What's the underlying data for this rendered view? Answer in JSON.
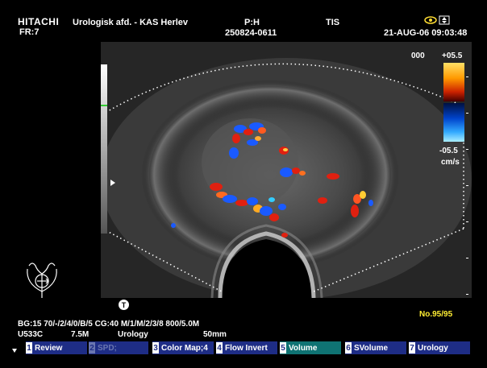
{
  "header": {
    "brand": "HITACHI",
    "frame_rate": "FR:7",
    "institution": "Urologisk afd. - KAS Herlev",
    "patient_label": "P:H",
    "patient_id": "250824-0611",
    "tis": "TIS",
    "datetime": "21-AUG-06 09:03:48"
  },
  "color_scale": {
    "code": "000",
    "max": "+05.5",
    "min": "-05.5",
    "unit": "cm/s"
  },
  "settings": {
    "line1": "BG:15    70/-/2/4/0/B/5    CG:40   M/1/M/2/3/8 800/5.0M",
    "line2_probe": "U533C",
    "line2_freq": "7.5M",
    "line2_preset": "Urology",
    "line2_depth": "50mm"
  },
  "frame_counter": "No.95/95",
  "marker_label": "T",
  "softkeys": [
    {
      "num": "1",
      "label": "Review"
    },
    {
      "num": "2",
      "label": "SPD;"
    },
    {
      "num": "3",
      "label": "Color Map;4"
    },
    {
      "num": "4",
      "label": "Flow Invert"
    },
    {
      "num": "5",
      "label": "Volume"
    },
    {
      "num": "6",
      "label": "SVolume"
    },
    {
      "num": "7",
      "label": "Urology"
    }
  ],
  "colors": {
    "softkey_bg": "#1e2d86",
    "softkey_teal": "#0f7373",
    "frame_counter": "#ffee33",
    "flow_red": "#e02010",
    "flow_blue": "#1a5aff"
  },
  "icons": [
    "bladder-probe-icon",
    "eye-icon",
    "status-icon",
    "play-arrow-icon"
  ]
}
